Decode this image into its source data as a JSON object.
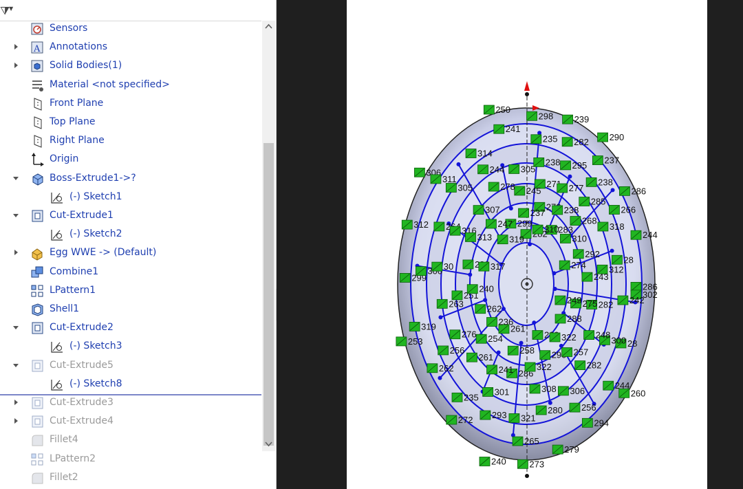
{
  "feature_tree": {
    "items": [
      {
        "label": "Sensors",
        "icon": "sensors-icon",
        "arrow": "none",
        "indent": 0,
        "dim": false
      },
      {
        "label": "Annotations",
        "icon": "annotations-icon",
        "arrow": "collapsed",
        "indent": 0,
        "dim": false
      },
      {
        "label": "Solid Bodies(1)",
        "icon": "solid-bodies-icon",
        "arrow": "collapsed",
        "indent": 0,
        "dim": false
      },
      {
        "label": "Material <not specified>",
        "icon": "material-icon",
        "arrow": "none",
        "indent": 0,
        "dim": false
      },
      {
        "label": "Front Plane",
        "icon": "plane-icon",
        "arrow": "none",
        "indent": 0,
        "dim": false
      },
      {
        "label": "Top Plane",
        "icon": "plane-icon",
        "arrow": "none",
        "indent": 0,
        "dim": false
      },
      {
        "label": "Right Plane",
        "icon": "plane-icon",
        "arrow": "none",
        "indent": 0,
        "dim": false
      },
      {
        "label": "Origin",
        "icon": "origin-icon",
        "arrow": "none",
        "indent": 0,
        "dim": false
      },
      {
        "label": "Boss-Extrude1->?",
        "icon": "boss-extrude-icon",
        "arrow": "expanded",
        "indent": 0,
        "dim": false
      },
      {
        "label": "(-) Sketch1",
        "icon": "sketch-icon",
        "arrow": "none",
        "indent": 1,
        "dim": false
      },
      {
        "label": "Cut-Extrude1",
        "icon": "cut-extrude-icon",
        "arrow": "expanded",
        "indent": 0,
        "dim": false
      },
      {
        "label": "(-) Sketch2",
        "icon": "sketch-icon",
        "arrow": "none",
        "indent": 1,
        "dim": false
      },
      {
        "label": "Egg WWE -> (Default)",
        "icon": "part-icon",
        "arrow": "collapsed",
        "indent": 0,
        "dim": false
      },
      {
        "label": "Combine1",
        "icon": "combine-icon",
        "arrow": "none",
        "indent": 0,
        "dim": false
      },
      {
        "label": "LPattern1",
        "icon": "linear-pattern-icon",
        "arrow": "none",
        "indent": 0,
        "dim": false
      },
      {
        "label": "Shell1",
        "icon": "shell-icon",
        "arrow": "none",
        "indent": 0,
        "dim": false
      },
      {
        "label": "Cut-Extrude2",
        "icon": "cut-extrude-icon",
        "arrow": "expanded",
        "indent": 0,
        "dim": false
      },
      {
        "label": "(-) Sketch3",
        "icon": "sketch-icon",
        "arrow": "none",
        "indent": 1,
        "dim": false
      },
      {
        "label": "Cut-Extrude5",
        "icon": "cut-extrude-icon",
        "arrow": "expanded",
        "indent": 0,
        "dim": true
      },
      {
        "label": "(-) Sketch8",
        "icon": "sketch-icon",
        "arrow": "none",
        "indent": 1,
        "dim": false
      },
      {
        "label": "Cut-Extrude3",
        "icon": "cut-extrude-icon",
        "arrow": "collapsed",
        "indent": 0,
        "dim": true
      },
      {
        "label": "Cut-Extrude4",
        "icon": "cut-extrude-icon",
        "arrow": "collapsed",
        "indent": 0,
        "dim": true
      },
      {
        "label": "Fillet4",
        "icon": "fillet-icon",
        "arrow": "none",
        "indent": 0,
        "dim": true
      },
      {
        "label": "LPattern2",
        "icon": "linear-pattern-icon",
        "arrow": "none",
        "indent": 0,
        "dim": true
      },
      {
        "label": "Fillet2",
        "icon": "fillet-icon",
        "arrow": "none",
        "indent": 0,
        "dim": true
      }
    ]
  },
  "viewport": {
    "colors": {
      "sketch_line": "#1414d8",
      "relation_marker": "#21b521",
      "body_fill": "#c9cde6",
      "background": "#1f1f1f",
      "sheet": "#ffffff"
    },
    "labels": [
      "282",
      "271",
      "282",
      "283",
      "285",
      "286",
      "292",
      "28",
      "286",
      "282",
      "28",
      "288",
      "282",
      "294",
      "290",
      "280",
      "273",
      "286",
      "293",
      "261",
      "261",
      "262",
      "262",
      "263",
      "299",
      "289",
      "264",
      "306",
      "307",
      "314",
      "299",
      "305",
      "298",
      "270",
      "295",
      "290",
      "268",
      "266",
      "274",
      "312",
      "302",
      "275",
      "300",
      "260",
      "257",
      "256",
      "269",
      "308",
      "265",
      "258",
      "301",
      "272",
      "254",
      "256",
      "253",
      "251",
      "300",
      "317",
      "316",
      "311",
      "247",
      "244",
      "250",
      "245",
      "235",
      "310",
      "277",
      "237",
      "310",
      "318",
      "244",
      "243",
      "242",
      "249",
      "248",
      "244",
      "322",
      "306",
      "279",
      "322",
      "321",
      "240",
      "241",
      "235",
      "236",
      "276",
      "319",
      "240",
      "30",
      "312",
      "313",
      "305",
      "319",
      "278",
      "241",
      "237",
      "238",
      "239",
      "238",
      "238"
    ]
  }
}
